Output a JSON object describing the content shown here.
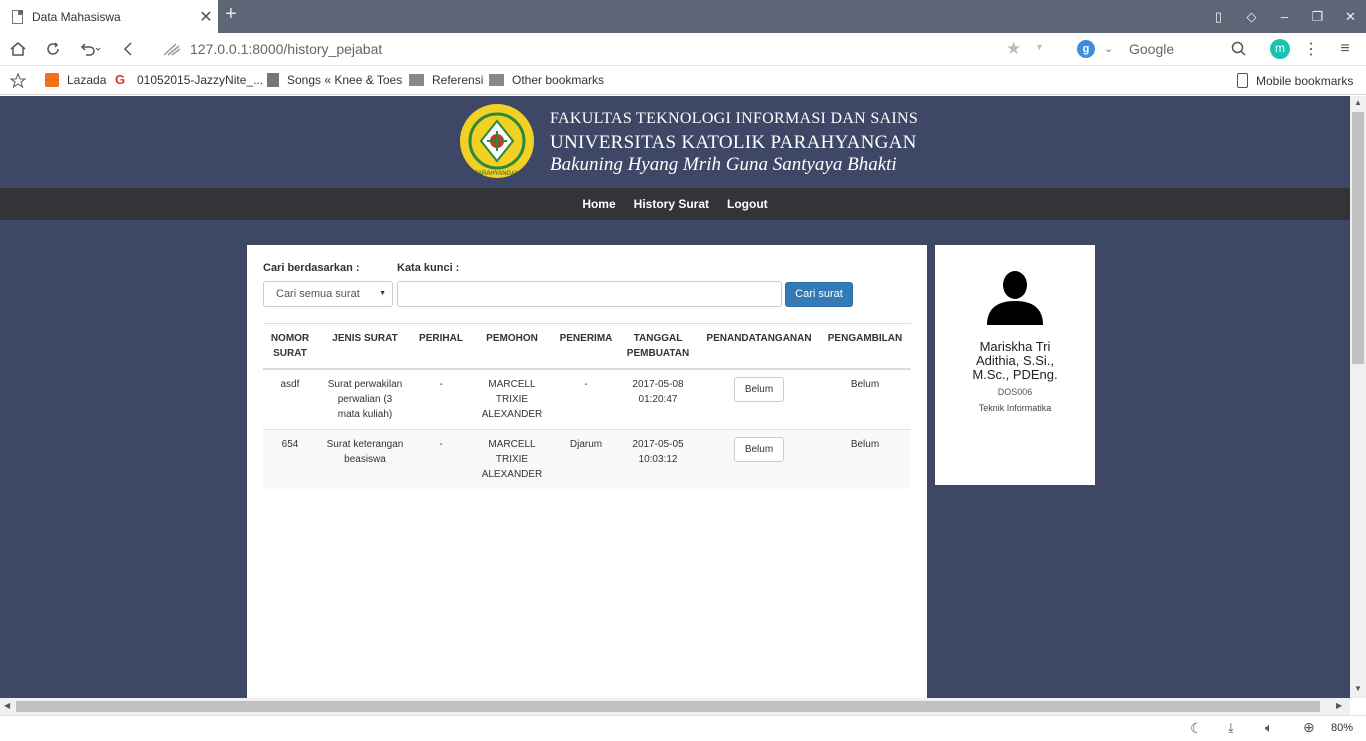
{
  "browser": {
    "tab_title": "Data Mahasiswa",
    "tab_close": "✕",
    "new_tab": "+",
    "url": "127.0.0.1:8000/history_pejabat",
    "search_engine_letter": "g",
    "search_placeholder": "Google",
    "extension_letter": "m",
    "zoom": "80%"
  },
  "bookmarks": [
    "Lazada",
    "01052015-JazzyNite_...",
    "Songs « Knee & Toes",
    "Referensi",
    "Other bookmarks",
    "Mobile bookmarks"
  ],
  "header": {
    "line1": "FAKULTAS TEKNOLOGI INFORMASI DAN SAINS",
    "line2": "UNIVERSITAS KATOLIK PARAHYANGAN",
    "line3": "Bakuning Hyang Mrih Guna Santyaya Bhakti",
    "logo_text": "UNIVERSITAS KATOLIK PARAHYANGAN"
  },
  "nav": {
    "home": "Home",
    "history": "History Surat",
    "logout": "Logout"
  },
  "search": {
    "by_label": "Cari berdasarkan :",
    "keyword_label": "Kata kunci :",
    "select_value": "Cari semua surat",
    "keyword_value": "",
    "button": "Cari surat"
  },
  "table": {
    "headers": [
      [
        "NOMOR",
        "SURAT"
      ],
      [
        "JENIS SURAT",
        ""
      ],
      [
        "PERIHAL",
        ""
      ],
      [
        "PEMOHON",
        ""
      ],
      [
        "PENERIMA",
        ""
      ],
      [
        "TANGGAL",
        "PEMBUATAN"
      ],
      [
        "PENANDATANGANAN",
        ""
      ],
      [
        "PENGAMBILAN",
        ""
      ]
    ],
    "rows": [
      {
        "nomor": "asdf",
        "jenis": [
          "Surat perwakilan",
          "perwalian (3",
          "mata kuliah)"
        ],
        "perihal": "-",
        "pemohon": [
          "MARCELL",
          "TRIXIE",
          "ALEXANDER"
        ],
        "penerima": "-",
        "tanggal": [
          "2017-05-08",
          "01:20:47"
        ],
        "penandatanganan": "Belum",
        "pengambilan": "Belum"
      },
      {
        "nomor": "654",
        "jenis": [
          "Surat keterangan",
          "beasiswa",
          ""
        ],
        "perihal": "-",
        "pemohon": [
          "MARCELL",
          "TRIXIE",
          "ALEXANDER"
        ],
        "penerima": "Djarum",
        "tanggal": [
          "2017-05-05",
          "10:03:12"
        ],
        "penandatanganan": "Belum",
        "pengambilan": "Belum"
      }
    ]
  },
  "profile": {
    "name_line1": "Mariskha Tri",
    "name_line2": "Adithia, S.Si.,",
    "name_line3": "M.Sc., PDEng.",
    "id": "DOS006",
    "department": "Teknik Informatika"
  },
  "colors": {
    "page_bg": "#3e4866",
    "nav_bg": "#323437",
    "button_primary": "#337ab7",
    "logo_yellow": "#f2d024",
    "logo_green": "#2a8a3a"
  }
}
